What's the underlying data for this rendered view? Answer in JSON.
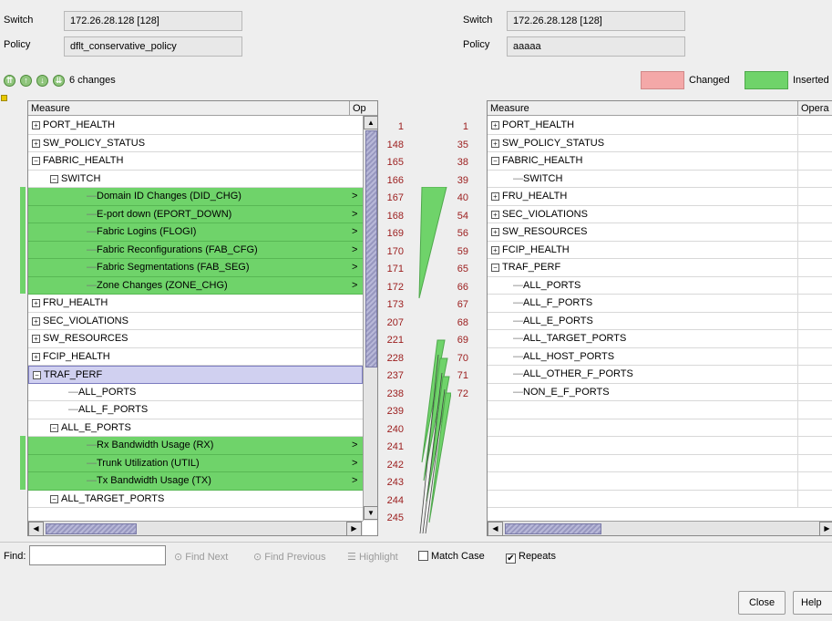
{
  "left": {
    "switch_label": "Switch",
    "switch_value": "172.26.28.128 [128]",
    "policy_label": "Policy",
    "policy_value": "dflt_conservative_policy",
    "changes_text": "6 changes",
    "col_measure": "Measure",
    "col_op": "Op",
    "rows": [
      {
        "text": "PORT_HEALTH",
        "indent": 0,
        "exp": "+",
        "op": "",
        "kind": "plain",
        "num": "1"
      },
      {
        "text": "SW_POLICY_STATUS",
        "indent": 0,
        "exp": "+",
        "op": "",
        "kind": "plain",
        "num": "148"
      },
      {
        "text": "FABRIC_HEALTH",
        "indent": 0,
        "exp": "-",
        "op": "",
        "kind": "plain",
        "num": "165"
      },
      {
        "text": "SWITCH",
        "indent": 1,
        "exp": "-",
        "op": "",
        "kind": "plain",
        "num": "166"
      },
      {
        "text": "Domain ID Changes (DID_CHG)",
        "indent": 3,
        "exp": "",
        "op": ">",
        "kind": "ins",
        "num": "167"
      },
      {
        "text": "E-port down (EPORT_DOWN)",
        "indent": 3,
        "exp": "",
        "op": ">",
        "kind": "ins",
        "num": "168"
      },
      {
        "text": "Fabric Logins (FLOGI)",
        "indent": 3,
        "exp": "",
        "op": ">",
        "kind": "ins",
        "num": "169"
      },
      {
        "text": "Fabric Reconfigurations (FAB_CFG)",
        "indent": 3,
        "exp": "",
        "op": ">",
        "kind": "ins",
        "num": "170"
      },
      {
        "text": "Fabric Segmentations (FAB_SEG)",
        "indent": 3,
        "exp": "",
        "op": ">",
        "kind": "ins",
        "num": "171"
      },
      {
        "text": "Zone Changes (ZONE_CHG)",
        "indent": 3,
        "exp": "",
        "op": ">",
        "kind": "ins",
        "num": "172"
      },
      {
        "text": "FRU_HEALTH",
        "indent": 0,
        "exp": "+",
        "op": "",
        "kind": "plain",
        "num": "173"
      },
      {
        "text": "SEC_VIOLATIONS",
        "indent": 0,
        "exp": "+",
        "op": "",
        "kind": "plain",
        "num": "207"
      },
      {
        "text": "SW_RESOURCES",
        "indent": 0,
        "exp": "+",
        "op": "",
        "kind": "plain",
        "num": "221"
      },
      {
        "text": "FCIP_HEALTH",
        "indent": 0,
        "exp": "+",
        "op": "",
        "kind": "plain",
        "num": "228"
      },
      {
        "text": "TRAF_PERF",
        "indent": 0,
        "exp": "-",
        "op": "",
        "kind": "sel",
        "num": "237"
      },
      {
        "text": "ALL_PORTS",
        "indent": 2,
        "exp": "",
        "op": "",
        "kind": "plain",
        "num": "238"
      },
      {
        "text": "ALL_F_PORTS",
        "indent": 2,
        "exp": "",
        "op": "",
        "kind": "plain",
        "num": "239"
      },
      {
        "text": "ALL_E_PORTS",
        "indent": 1,
        "exp": "-",
        "op": "",
        "kind": "plain",
        "num": "240"
      },
      {
        "text": "Rx Bandwidth Usage (RX)",
        "indent": 3,
        "exp": "",
        "op": ">",
        "kind": "ins",
        "num": "241"
      },
      {
        "text": "Trunk Utilization (UTIL)",
        "indent": 3,
        "exp": "",
        "op": ">",
        "kind": "ins",
        "num": "242"
      },
      {
        "text": "Tx Bandwidth Usage (TX)",
        "indent": 3,
        "exp": "",
        "op": ">",
        "kind": "ins",
        "num": "243"
      },
      {
        "text": "ALL_TARGET_PORTS",
        "indent": 1,
        "exp": "-",
        "op": "",
        "kind": "plain",
        "num": "244"
      }
    ],
    "last_num": "245"
  },
  "right": {
    "switch_label": "Switch",
    "switch_value": "172.26.28.128 [128]",
    "policy_label": "Policy",
    "policy_value": "aaaaa",
    "legend_changed": "Changed",
    "legend_inserted": "Inserted",
    "col_measure": "Measure",
    "col_op": "Opera",
    "rows": [
      {
        "text": "PORT_HEALTH",
        "indent": 0,
        "exp": "+",
        "num": "1"
      },
      {
        "text": "SW_POLICY_STATUS",
        "indent": 0,
        "exp": "+",
        "num": "35"
      },
      {
        "text": "FABRIC_HEALTH",
        "indent": 0,
        "exp": "-",
        "num": "38"
      },
      {
        "text": "SWITCH",
        "indent": 2,
        "exp": "",
        "num": "39"
      },
      {
        "text": "FRU_HEALTH",
        "indent": 0,
        "exp": "+",
        "num": "40"
      },
      {
        "text": "SEC_VIOLATIONS",
        "indent": 0,
        "exp": "+",
        "num": "54"
      },
      {
        "text": "SW_RESOURCES",
        "indent": 0,
        "exp": "+",
        "num": "56"
      },
      {
        "text": "FCIP_HEALTH",
        "indent": 0,
        "exp": "+",
        "num": "59"
      },
      {
        "text": "TRAF_PERF",
        "indent": 0,
        "exp": "-",
        "num": "65"
      },
      {
        "text": "ALL_PORTS",
        "indent": 2,
        "exp": "",
        "num": "66"
      },
      {
        "text": "ALL_F_PORTS",
        "indent": 2,
        "exp": "",
        "num": "67"
      },
      {
        "text": "ALL_E_PORTS",
        "indent": 2,
        "exp": "",
        "num": "68"
      },
      {
        "text": "ALL_TARGET_PORTS",
        "indent": 2,
        "exp": "",
        "num": "69"
      },
      {
        "text": "ALL_HOST_PORTS",
        "indent": 2,
        "exp": "",
        "num": "70"
      },
      {
        "text": "ALL_OTHER_F_PORTS",
        "indent": 2,
        "exp": "",
        "num": "71"
      },
      {
        "text": "NON_E_F_PORTS",
        "indent": 2,
        "exp": "",
        "num": "72"
      }
    ]
  },
  "find": {
    "label": "Find:",
    "value": "",
    "find_next": "Find Next",
    "find_previous": "Find Previous",
    "highlight": "Highlight",
    "match_case": "Match Case",
    "repeats": "Repeats",
    "match_case_checked": false,
    "repeats_checked": true
  },
  "buttons": {
    "close": "Close",
    "help": "Help"
  },
  "colors": {
    "inserted": "#6fd36a",
    "changed": "#f4a8a8",
    "line_number": "#9b1c1c"
  }
}
